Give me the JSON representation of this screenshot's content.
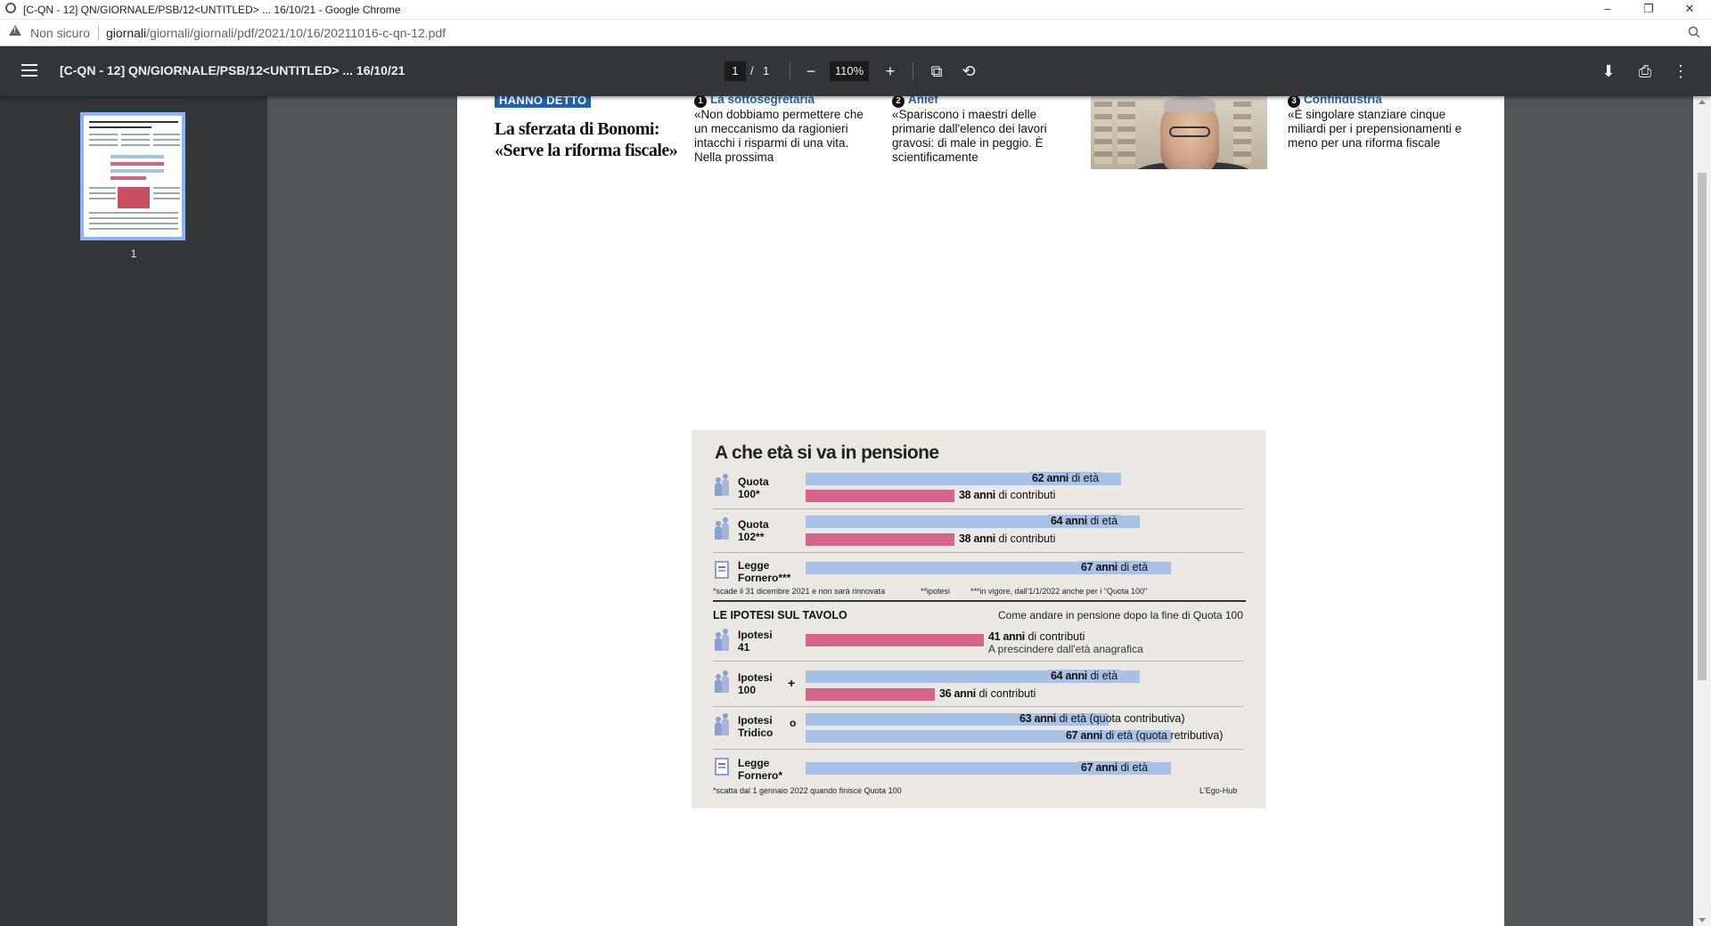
{
  "window": {
    "title": "[C-QN - 12] QN/GIORNALE/PSB/12<UNTITLED> ... 16/10/21 - Google Chrome",
    "controls": {
      "minimize": "–",
      "restore": "❐",
      "close": "✕"
    }
  },
  "addressbar": {
    "security_label": "Non sicuro",
    "url_host": "giornali",
    "url_path": "/giornali/giornali/pdf/2021/10/16/20211016-c-qn-12.pdf"
  },
  "pdf_toolbar": {
    "doc_title": "[C-QN - 12] QN/GIORNALE/PSB/12<UNTITLED> ... 16/10/21",
    "current_page": "1",
    "page_separator": "/",
    "total_pages": "1",
    "zoom": "110%",
    "zoom_out": "−",
    "zoom_in": "+",
    "fit_icon": "⧉",
    "rotate_icon": "⟲",
    "download_icon": "⬇",
    "print_icon": "⎙",
    "more_icon": "⋮"
  },
  "sidebar": {
    "thumbnail_label": "1"
  },
  "header_strip": {
    "badge": "HANNO DETTO",
    "headline_1": "La sferzata di Bonomi:",
    "headline_2": "«Serve la riforma fiscale»",
    "col1": {
      "num": "1",
      "title": "La sottosegretaria",
      "text": "«Non dobbiamo permettere che un meccanismo da ragionieri intacchi i risparmi di una vita. Nella prossima"
    },
    "col2": {
      "num": "2",
      "title": "Anief",
      "text": "«Spariscono i maestri delle primarie dall'elenco dei lavori gravosi: di male in peggio. È scientificamente"
    },
    "col3": {
      "num": "3",
      "title": "Confindustria",
      "text": "«È singolare stanziare cinque miliardi per i prepensionamenti e meno per una riforma fiscale"
    }
  },
  "infographic": {
    "title": "A che età si va in pensione",
    "rows": [
      {
        "label_1": "Quota",
        "label_2": "100*",
        "age_num": "62 anni",
        "age_txt": " di età",
        "contrib_num": "38 anni",
        "contrib_txt": " di contributi"
      },
      {
        "label_1": "Quota",
        "label_2": "102**",
        "age_num": "64 anni",
        "age_txt": " di età",
        "contrib_num": "38 anni",
        "contrib_txt": " di contributi"
      },
      {
        "label_1": "Legge",
        "label_2": "Fornero***",
        "age_num": "67 anni",
        "age_txt": " di età"
      }
    ],
    "footnotes": {
      "a": "*scade il 31 dicembre 2021 e non sarà rinnovata",
      "b": "**ipotesi",
      "c": "***in vigore, dall'1/1/2022 anche per i \"Quota 100\""
    },
    "section_title": "LE IPOTESI SUL TAVOLO",
    "section_subtitle": "Come andare in pensione dopo la fine di Quota 100",
    "hyp": [
      {
        "label_1": "Ipotesi",
        "label_2": "41",
        "contrib_num": "41 anni",
        "contrib_txt": " di contributi",
        "note": "A prescindere dall'età anagrafica"
      },
      {
        "label_1": "Ipotesi",
        "label_2": "100",
        "op": "+",
        "age_num": "64 anni",
        "age_txt": " di età",
        "contrib_num": "36 anni",
        "contrib_txt": " di contributi"
      },
      {
        "label_1": "Ipotesi",
        "label_2": "Tridico",
        "op": "o",
        "a_num": "63 anni",
        "a_txt": " di età (quota contributiva)",
        "b_num": "67 anni",
        "b_txt": " di età (quota retributiva)"
      },
      {
        "label_1": "Legge",
        "label_2": "Fornero*",
        "age_num": "67 anni",
        "age_txt": " di età"
      }
    ],
    "bottom_note": "*scatta dal 1 gennaio 2022 quando finisce Quota 100",
    "credit": "L'Ego-Hub",
    "colors": {
      "age_bar": "#a8c1e6",
      "contrib_bar": "#d4648a",
      "panel": "#ebe8e4"
    }
  }
}
